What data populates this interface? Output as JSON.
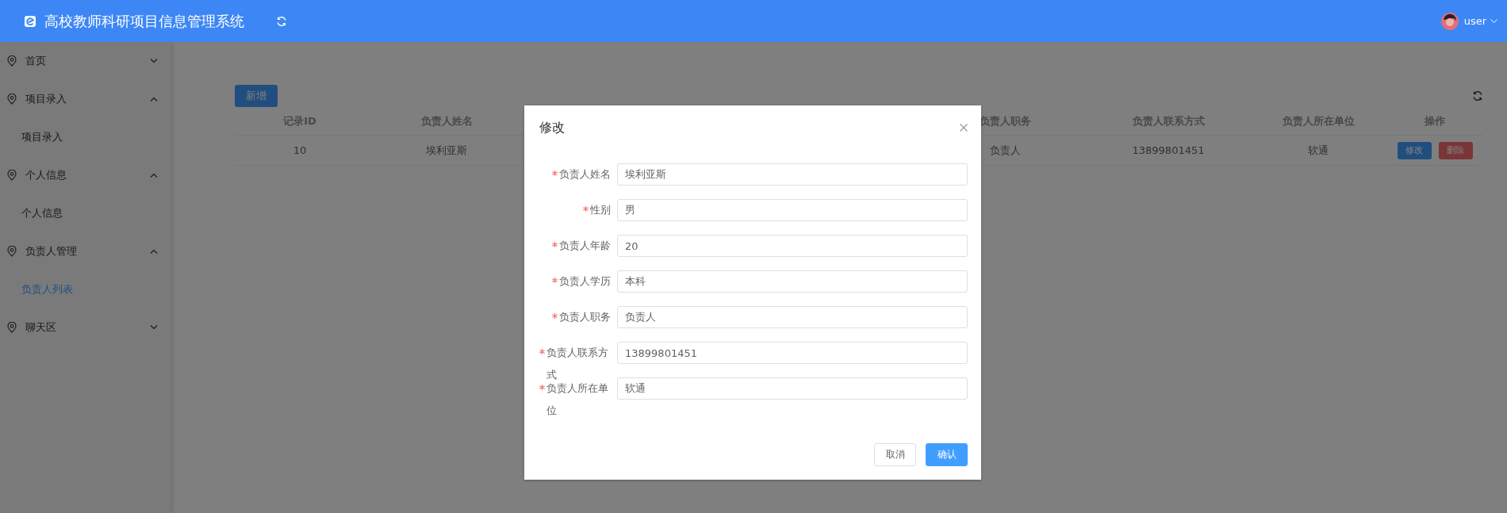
{
  "header": {
    "title": "高校教师科研项目信息管理系统",
    "user": "user"
  },
  "sidebar": {
    "menu": [
      {
        "label": "首页",
        "expanded": false
      },
      {
        "label": "项目录入",
        "expanded": true,
        "children": [
          {
            "label": "项目录入",
            "selected": false
          }
        ]
      },
      {
        "label": "个人信息",
        "expanded": true,
        "children": [
          {
            "label": "个人信息",
            "selected": false
          }
        ]
      },
      {
        "label": "负责人管理",
        "expanded": true,
        "children": [
          {
            "label": "负责人列表",
            "selected": true
          }
        ]
      },
      {
        "label": "聊天区",
        "expanded": false
      }
    ]
  },
  "toolbar": {
    "add_button": "新增"
  },
  "table": {
    "columns": [
      "记录ID",
      "负责人姓名",
      "负责人职务",
      "负责人联系方式",
      "负责人所在单位",
      "操作"
    ],
    "rows": [
      {
        "cells": [
          "10",
          "埃利亚斯",
          "负责人",
          "13899801451",
          "软通"
        ],
        "actions": [
          {
            "label": "修改",
            "kind": "edit"
          },
          {
            "label": "删除",
            "kind": "delete"
          }
        ]
      }
    ]
  },
  "dialog": {
    "title": "修改",
    "fields": [
      {
        "label": "负责人姓名",
        "value": "埃利亚斯",
        "required": true
      },
      {
        "label": "性别",
        "value": "男",
        "required": true
      },
      {
        "label": "负责人年龄",
        "value": "20",
        "required": true
      },
      {
        "label": "负责人学历",
        "value": "本科",
        "required": true
      },
      {
        "label": "负责人职务",
        "value": "负责人",
        "required": true
      },
      {
        "label": "负责人联系方式",
        "value": "13899801451",
        "required": true
      },
      {
        "label": "负责人所在单位",
        "value": "软通",
        "required": true
      }
    ],
    "buttons": [
      {
        "label": "取消",
        "kind": "default"
      },
      {
        "label": "确认",
        "kind": "primary"
      }
    ]
  }
}
